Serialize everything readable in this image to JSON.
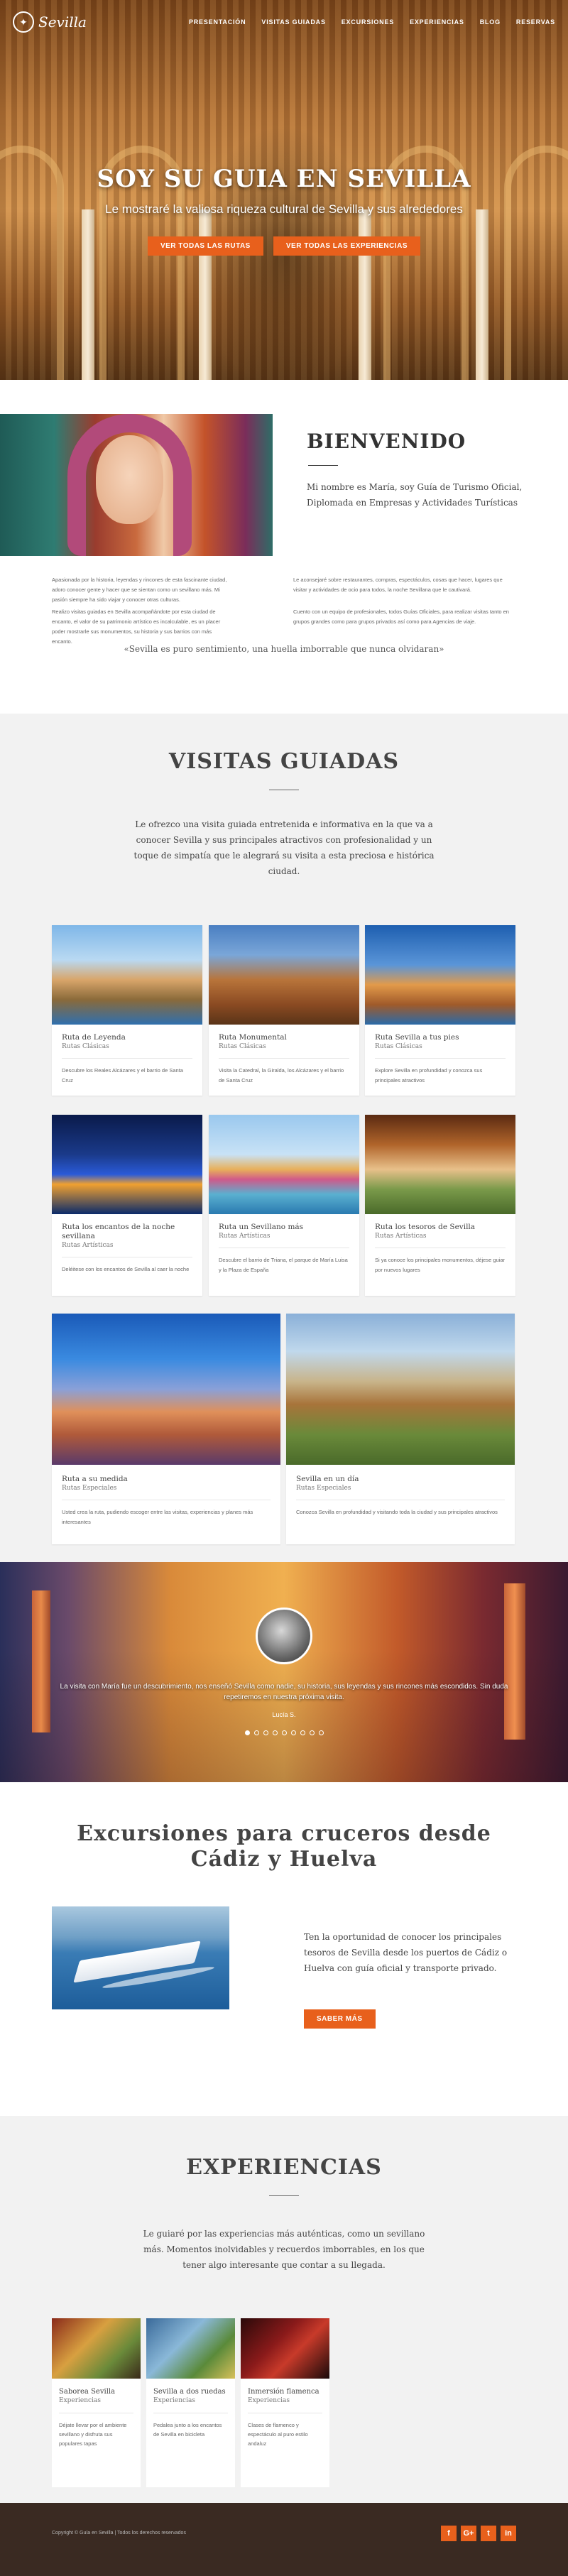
{
  "nav": {
    "logo_text": "Sevilla",
    "items": [
      "Presentación",
      "Visitas guiadas",
      "Excursiones",
      "Experiencias",
      "Blog",
      "Reservas"
    ]
  },
  "hero": {
    "title": "SOY SU GUIA EN SEVILLA",
    "subtitle": "Le mostraré la valiosa riqueza cultural de Sevilla y sus alrededores",
    "btn_routes": "Ver todas las rutas",
    "btn_experiences": "Ver todas las experiencias"
  },
  "welcome": {
    "title": "BIENVENIDO",
    "lead": "Mi nombre es María, soy Guía de Turismo Oficial, Diplomada en Empresas y Actividades Turísticas",
    "p_left_1": "Apasionada por la historia, leyendas y rincones de esta fascinante ciudad, adoro conocer gente y hacer que se sientan como un sevillano más. Mi pasión siempre ha sido viajar y conocer otras culturas.",
    "p_left_2": "Realizo visitas guiadas en Sevilla acompañándote por esta ciudad de encanto, el valor de su patrimonio artístico es incalculable, es un placer poder mostrarle sus monumentos, su historia y sus barrios con más encanto.",
    "p_right_1": "Le aconsejaré sobre restaurantes, compras, espectáculos, cosas que hacer, lugares que visitar y actividades de ocio para todos, la noche Sevillana que le cautivará.",
    "p_right_2": "Cuento con un equipo de profesionales, todos Guías Oficiales, para realizar visitas tanto en grupos grandes como para grupos privados así como para Agencias de viaje.",
    "quote": "«Sevilla es puro sentimiento, una huella imborrable que nunca olvidaran»"
  },
  "tours": {
    "title": "VISITAS GUIADAS",
    "lead": "Le ofrezco una visita guiada entretenida e informativa en la que va a conocer Sevilla y sus principales atractivos con profesionalidad y un toque de simpatía que le alegrará su visita a esta preciosa e histórica ciudad.",
    "cards": [
      {
        "title": "Ruta de Leyenda",
        "cat": "Rutas Clásicas",
        "desc": "Descubre los Reales Alcázares y el barrio de Santa Cruz"
      },
      {
        "title": "Ruta Monumental",
        "cat": "Rutas Clásicas",
        "desc": "Visita la Catedral, la Giralda, los Alcázares y el barrio de Santa Cruz"
      },
      {
        "title": "Ruta Sevilla a tus pies",
        "cat": "Rutas Clásicas",
        "desc": "Explore Sevilla en profundidad y conozca sus principales atractivos"
      },
      {
        "title": "Ruta los encantos de la noche sevillana",
        "cat": "Rutas Artísticas",
        "desc": "Deléitese con los encantos de Sevilla al caer la noche"
      },
      {
        "title": "Ruta un Sevillano más",
        "cat": "Rutas Artísticas",
        "desc": "Descubre el barrio de Triana, el parque de María Luisa y la Plaza de España"
      },
      {
        "title": "Ruta los tesoros de Sevilla",
        "cat": "Rutas Artísticas",
        "desc": "Si ya conoce los principales monumentos, déjese guiar por nuevos lugares"
      },
      {
        "title": "Ruta a su medida",
        "cat": "Rutas Especiales",
        "desc": "Usted crea la ruta, pudiendo escoger entre las visitas, experiencias y planes más interesantes"
      },
      {
        "title": "Sevilla en un día",
        "cat": "Rutas Especiales",
        "desc": "Conozca Sevilla en profundidad y visitando toda la ciudad y sus principales atractivos"
      }
    ]
  },
  "testimonial": {
    "quote": "La visita con María fue un descubrimiento, nos enseñó Sevilla como nadie, su historia, sus leyendas y sus rincones más escondidos. Sin duda repetiremos en nuestra próxima visita.",
    "author": "Lucía S."
  },
  "cruise": {
    "title": "Excursiones para cruceros desde Cádiz y Huelva",
    "text": "Ten la oportunidad de conocer los principales tesoros de Sevilla desde los puertos de Cádiz o Huelva con guía oficial y transporte privado.",
    "btn": "Saber más"
  },
  "experiences": {
    "title": "EXPERIENCIAS",
    "lead": "Le guiaré por las experiencias más auténticas, como un sevillano más. Momentos inolvidables y recuerdos imborrables, en los que tener algo interesante que contar a su llegada.",
    "cards": [
      {
        "title": "Saborea Sevilla",
        "cat": "Experiencias",
        "desc": "Déjate llevar por el ambiente sevillano y disfruta sus populares tapas"
      },
      {
        "title": "Sevilla a dos ruedas",
        "cat": "Experiencias",
        "desc": "Pedalea junto a los encantos de Sevilla en bicicleta"
      },
      {
        "title": "Inmersión flamenca",
        "cat": "Experiencias",
        "desc": "Clases de flamenco y espectáculo al puro estilo andaluz"
      }
    ]
  },
  "footer": {
    "copyright": "Copyright © Guía en Sevilla  |  Todos los derechos reservados",
    "social": [
      "f",
      "G+",
      "t",
      "in"
    ]
  }
}
